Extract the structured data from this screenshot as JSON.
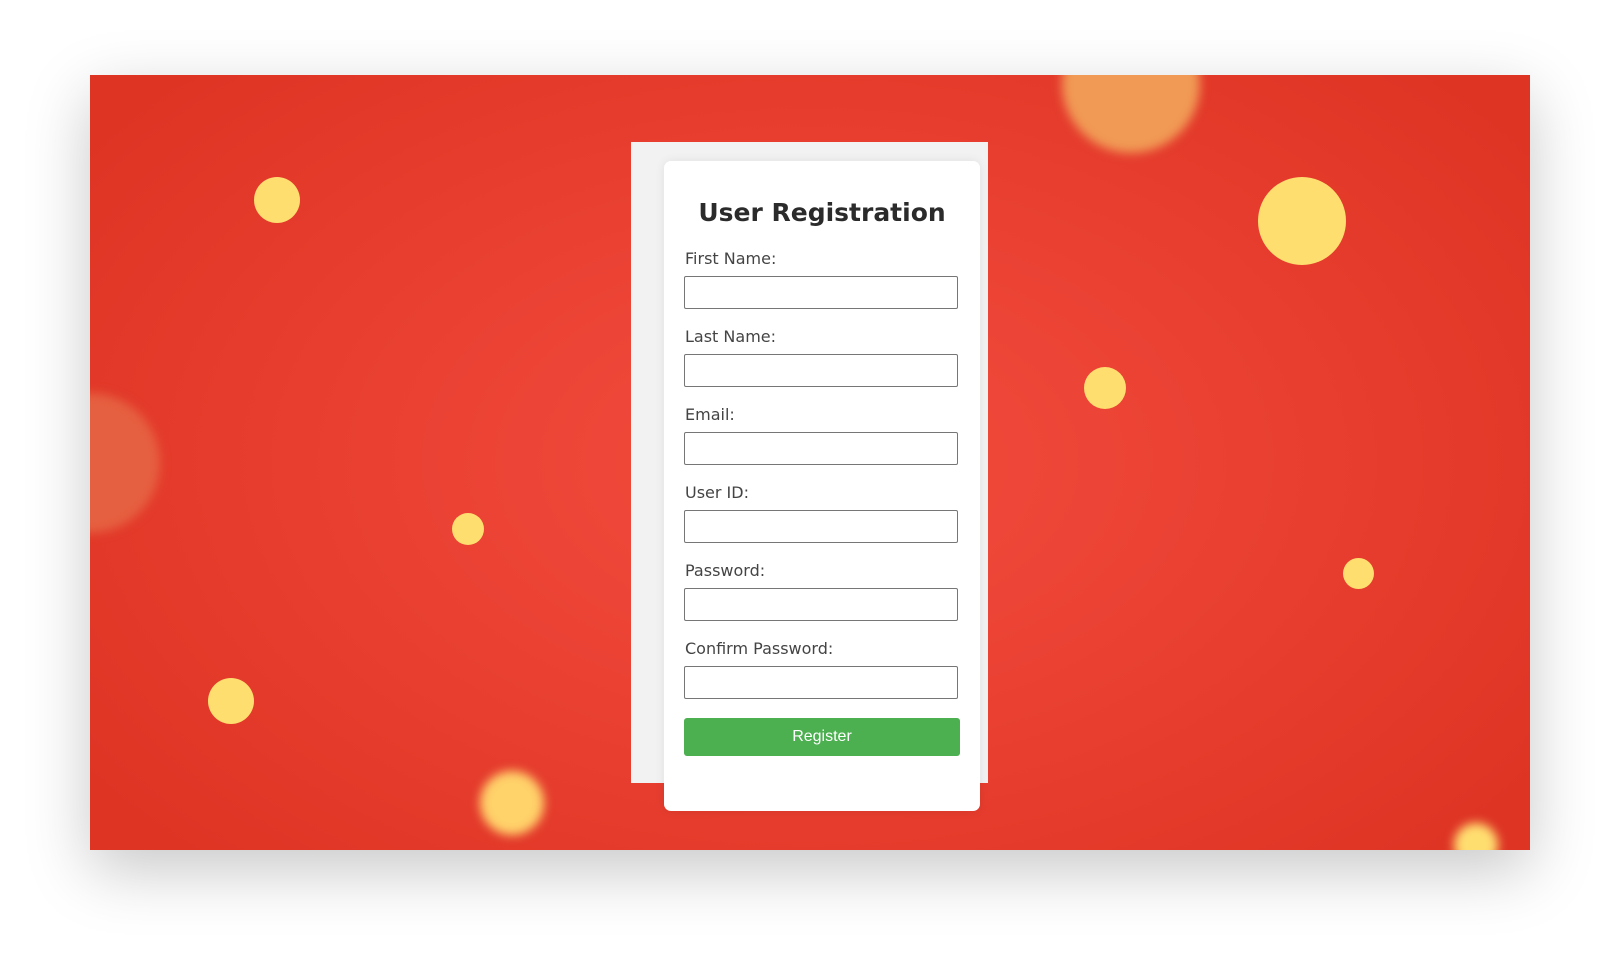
{
  "form": {
    "title": "User Registration",
    "fields": [
      {
        "label": "First Name:",
        "value": "",
        "placeholder": ""
      },
      {
        "label": "Last Name:",
        "value": "",
        "placeholder": ""
      },
      {
        "label": "Email:",
        "value": "",
        "placeholder": ""
      },
      {
        "label": "User ID:",
        "value": "",
        "placeholder": ""
      },
      {
        "label": "Password:",
        "value": "",
        "placeholder": ""
      },
      {
        "label": "Confirm Password:",
        "value": "",
        "placeholder": ""
      }
    ],
    "submit_label": "Register"
  },
  "colors": {
    "background": "#e43a2b",
    "dots": "#ffde70",
    "button": "#4caf50"
  }
}
